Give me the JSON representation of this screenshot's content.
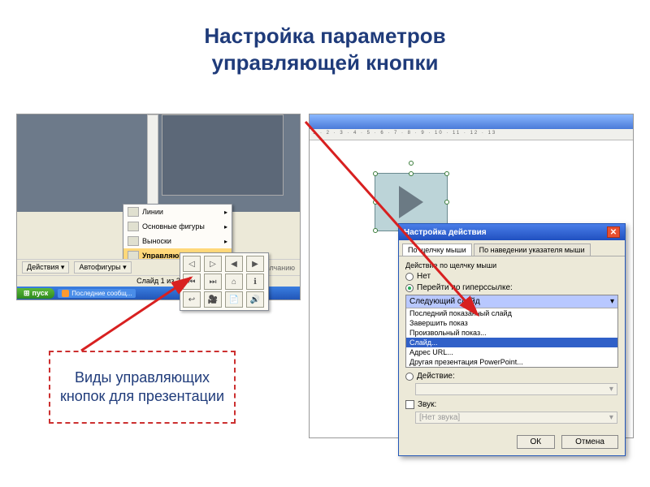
{
  "title_line1": "Настройка параметров",
  "title_line2": "управляющей кнопки",
  "caption": "Виды управляющих кнопок для презентации",
  "autoshapes_menu": {
    "items": [
      "Линии",
      "Основные фигуры",
      "Выноски",
      "Управляющие кнопки"
    ]
  },
  "buttons_grid_glyphs": [
    "◁",
    "▷",
    "◀",
    "▶",
    "⏮",
    "⏭",
    "⌂",
    "ℹ",
    "↩",
    "🎥",
    "📄",
    "🔊"
  ],
  "left_toolbar": {
    "actions_btn": "Действия ▾",
    "autoshapes_btn": "Автофигуры ▾",
    "default_note": "по умолчанию"
  },
  "status_bar": "Слайд 1 из 2",
  "taskbar": {
    "start": "пуск",
    "item": "Последние сообщ..."
  },
  "right_ruler": "1 · 2 · 3 · 4 · 5 · 6 · 7 · 8 · 9 · 10 · 11 · 12 · 13",
  "dialog": {
    "title": "Настройка действия",
    "tabs": {
      "active": "По щелчку мыши",
      "inactive": "По наведении указателя мыши"
    },
    "section_label": "Действие по щелчку мыши",
    "radios": {
      "none": "Нет",
      "hyperlink": "Перейти по гиперссылке:",
      "action": "Действие:"
    },
    "combo_selected": "Следующий слайд",
    "combo_options": [
      "Последний показанный слайд",
      "Завершить показ",
      "Произвольный показ...",
      "Слайд...",
      "Адрес URL...",
      "Другая презентация PowerPoint..."
    ],
    "combo_highlight_index": 3,
    "sound_check": "Звук:",
    "sound_value": "[Нет звука]",
    "buttons": {
      "ok": "ОК",
      "cancel": "Отмена"
    }
  }
}
